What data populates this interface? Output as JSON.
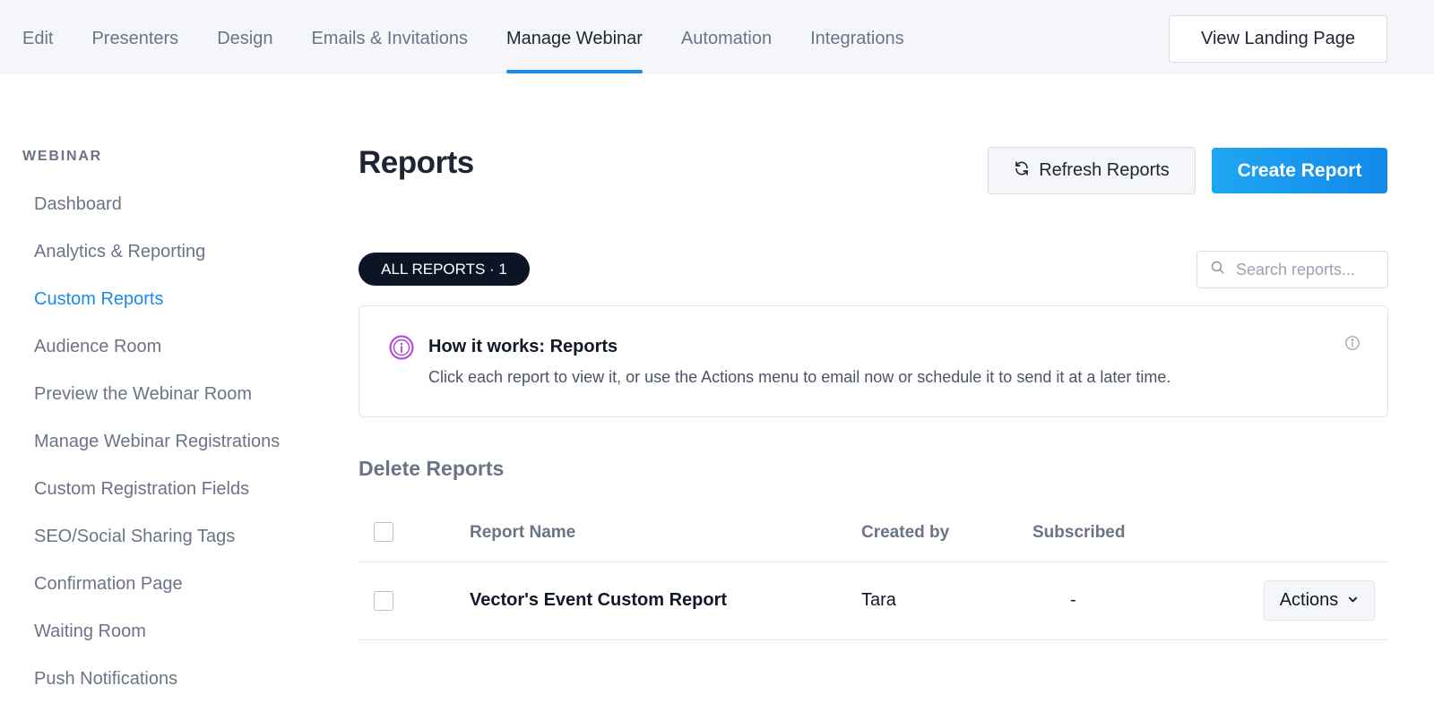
{
  "nav": {
    "tabs": [
      {
        "label": "Edit"
      },
      {
        "label": "Presenters"
      },
      {
        "label": "Design"
      },
      {
        "label": "Emails & Invitations"
      },
      {
        "label": "Manage Webinar"
      },
      {
        "label": "Automation"
      },
      {
        "label": "Integrations"
      }
    ],
    "active_tab": "Manage Webinar",
    "view_landing_label": "View Landing Page"
  },
  "sidebar": {
    "heading": "WEBINAR",
    "items": [
      {
        "label": "Dashboard"
      },
      {
        "label": "Analytics & Reporting"
      },
      {
        "label": "Custom Reports"
      },
      {
        "label": "Audience Room"
      },
      {
        "label": "Preview the Webinar Room"
      },
      {
        "label": "Manage Webinar Registrations"
      },
      {
        "label": "Custom Registration Fields"
      },
      {
        "label": "SEO/Social Sharing Tags"
      },
      {
        "label": "Confirmation Page"
      },
      {
        "label": "Waiting Room"
      },
      {
        "label": "Push Notifications"
      }
    ],
    "active_item": "Custom Reports"
  },
  "main": {
    "title": "Reports",
    "refresh_label": "Refresh Reports",
    "create_label": "Create Report",
    "filter_pill": "ALL REPORTS · 1",
    "search_placeholder": "Search reports...",
    "info": {
      "title": "How it works: Reports",
      "text": "Click each report to view it, or use the Actions menu to email now or schedule it to send it at a later time."
    },
    "section_title": "Delete Reports",
    "table": {
      "columns": [
        "Report Name",
        "Created by",
        "Subscribed"
      ],
      "rows": [
        {
          "name": "Vector's Event Custom Report",
          "created_by": "Tara",
          "subscribed": "-",
          "actions_label": "Actions"
        }
      ]
    }
  },
  "colors": {
    "accent": "#1a8ae8",
    "create_button": "#1289ea",
    "pill_bg": "#0c1526",
    "info_icon": "#b23fd6"
  }
}
